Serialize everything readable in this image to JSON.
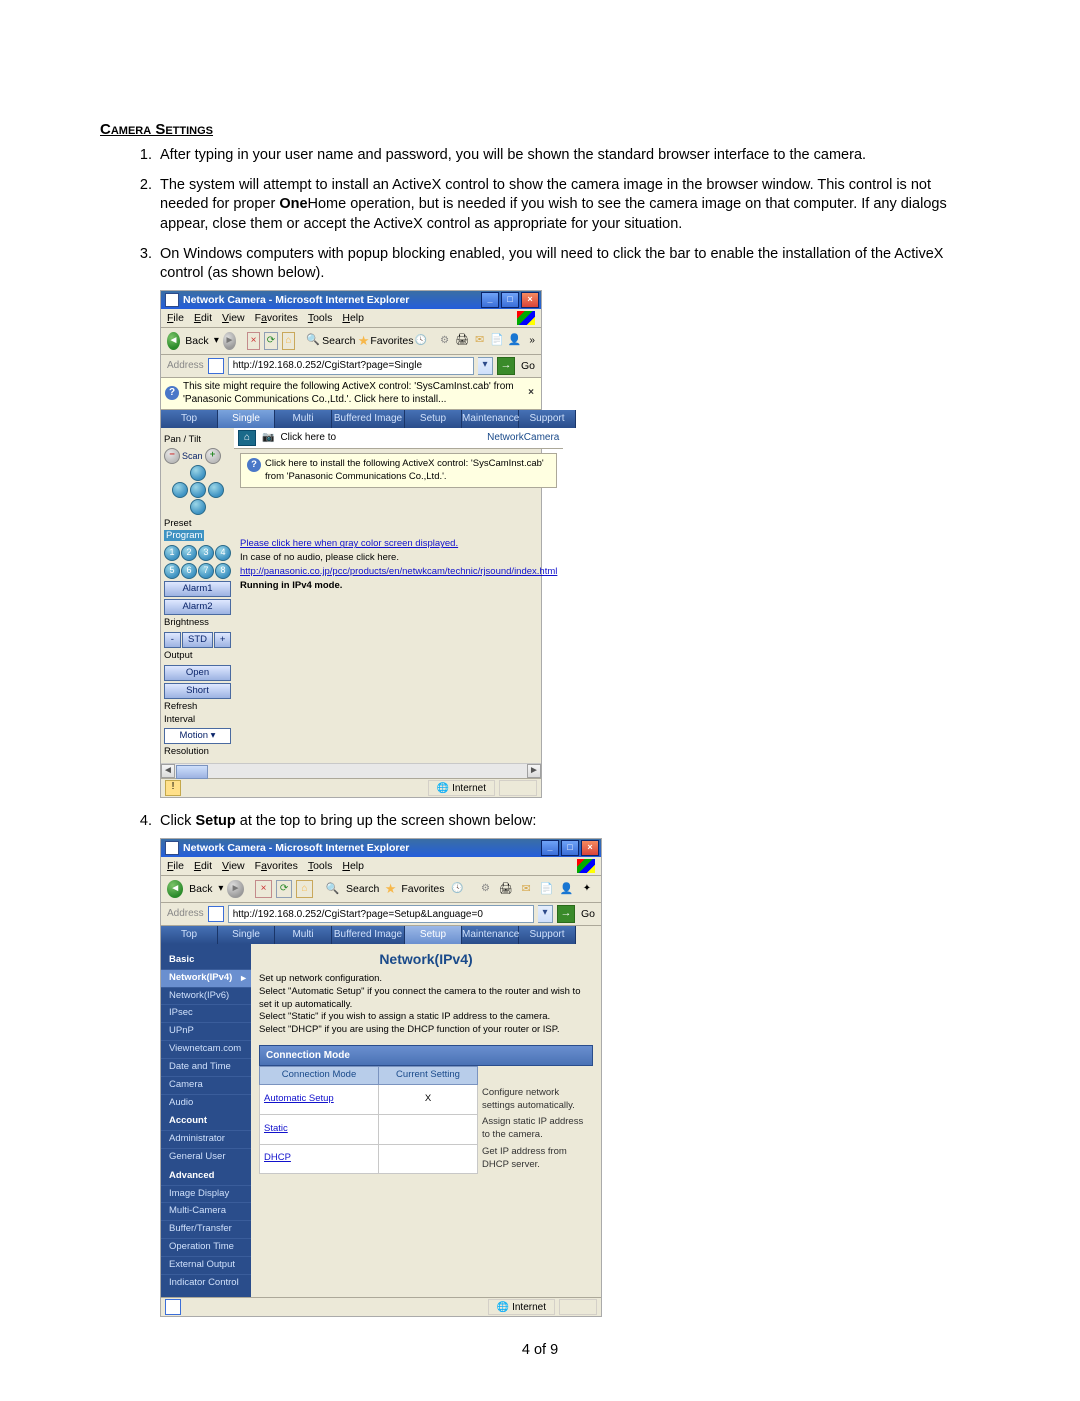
{
  "doc": {
    "section_title": "Camera Settings",
    "items": [
      "After typing in your user name and password, you will be shown the standard browser interface to the camera.",
      "The system will attempt to install an ActiveX control to show the camera image in the browser window.  This control is not needed for proper <b>One</b>Home operation, but is needed if you wish to see the camera image on that computer. If any dialogs appear, close them or accept the ActiveX control as appropriate for your situation.",
      "On Windows computers with popup blocking enabled, you will need to click the bar to enable the installation of the ActiveX control (as shown below).",
      "Click <b>Setup</b> at the top to bring up the screen shown below:"
    ],
    "page_number": "4 of 9"
  },
  "ie_common": {
    "title": "Network Camera - Microsoft Internet Explorer",
    "menus": {
      "file": "File",
      "edit": "Edit",
      "view": "View",
      "favorites": "Favorites",
      "tools": "Tools",
      "help": "Help"
    },
    "toolbar": {
      "back": "Back",
      "search": "Search",
      "favorites": "Favorites"
    },
    "addr_label": "Address",
    "go": "Go",
    "status_zone": "Internet"
  },
  "shot1": {
    "address": "http://192.168.0.252/CgiStart?page=Single",
    "infobar": "This site might require the following ActiveX control: 'SysCamInst.cab' from 'Panasonic Communications Co.,Ltd.'. Click here to install...",
    "tabs": [
      "Top",
      "Single",
      "Multi",
      "Buffered Image",
      "Setup",
      "Maintenance",
      "Support"
    ],
    "tab_selected": "Single",
    "mainbar": {
      "clickhere": "Click here to",
      "title": "NetworkCamera"
    },
    "msgbox": "Click here to install the following ActiveX control: 'SysCamInst.cab' from 'Panasonic Communications Co.,Ltd.'.",
    "side": {
      "pantilt": "Pan / Tilt",
      "scan": "Scan",
      "preset": "Preset",
      "program": "Program",
      "alarm1": "Alarm1",
      "alarm2": "Alarm2",
      "brightness": "Brightness",
      "std": "STD",
      "output": "Output",
      "open": "Open",
      "short": "Short",
      "refresh": "Refresh Interval",
      "motion": "Motion",
      "resolution": "Resolution"
    },
    "links": {
      "l1": "Please click here when gray color screen displayed.",
      "l2": "In case of no audio, please click here.",
      "l3": "http://panasonic.co.jp/pcc/products/en/netwkcam/technic/rjsound/index.html",
      "l4": "Running in IPv4 mode."
    }
  },
  "shot2": {
    "address": "http://192.168.0.252/CgiStart?page=Setup&Language=0",
    "tabs": [
      "Top",
      "Single",
      "Multi",
      "Buffered Image",
      "Setup",
      "Maintenance",
      "Support"
    ],
    "tab_selected": "Setup",
    "side": {
      "basic": "Basic",
      "items_basic": [
        "Network(IPv4)",
        "Network(IPv6)",
        "IPsec",
        "UPnP",
        "Viewnetcam.com",
        "Date and Time",
        "Camera",
        "Audio"
      ],
      "account": "Account",
      "items_account": [
        "Administrator",
        "General User"
      ],
      "advanced": "Advanced",
      "items_advanced": [
        "Image Display",
        "Multi-Camera",
        "Buffer/Transfer",
        "Operation Time",
        "External Output",
        "Indicator Control"
      ]
    },
    "main": {
      "title": "Network(IPv4)",
      "desc": "Set up network configuration.\nSelect \"Automatic Setup\" if you connect the camera to the router and wish to set it up automatically.\nSelect \"Static\" if you wish to assign a static IP address to the camera.\nSelect \"DHCP\" if you are using the DHCP function of your router or ISP.",
      "section": "Connection Mode",
      "th_mode": "Connection Mode",
      "th_cur": "Current Setting",
      "rows": [
        {
          "mode": "Automatic Setup",
          "cur": "X",
          "info": "Configure network settings automatically."
        },
        {
          "mode": "Static",
          "cur": "",
          "info": "Assign static IP address to the camera."
        },
        {
          "mode": "DHCP",
          "cur": "",
          "info": "Get IP address from DHCP server."
        }
      ]
    }
  }
}
